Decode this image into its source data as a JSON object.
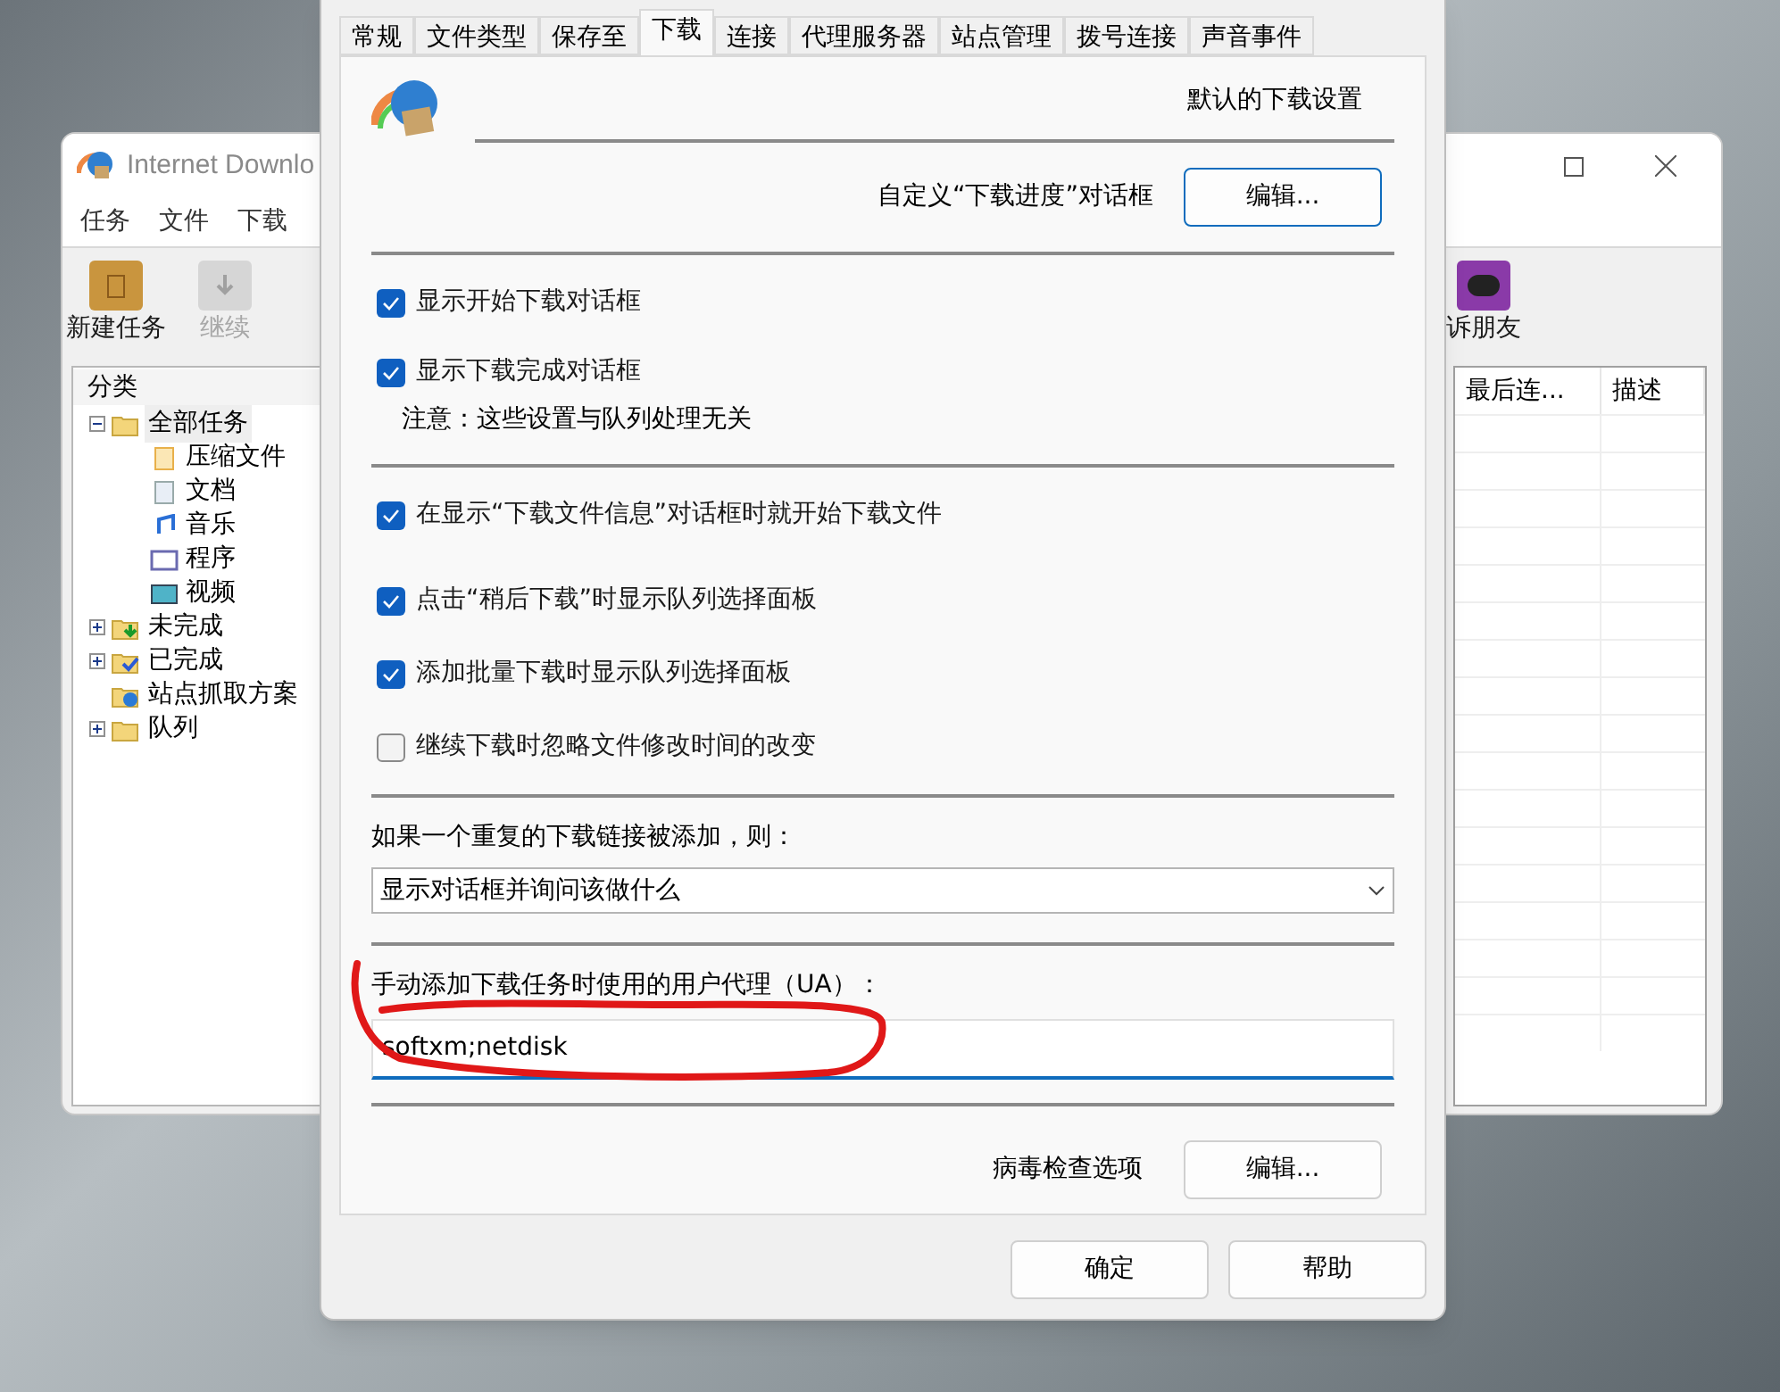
{
  "background_window": {
    "title": "Internet Downlo",
    "menu": [
      "任务",
      "文件",
      "下载"
    ],
    "toolbar": [
      {
        "label": "新建任务",
        "disabled": false,
        "kind": "new"
      },
      {
        "label": "继续",
        "disabled": true,
        "kind": "resume"
      }
    ],
    "toolbar_right": {
      "label": "诉朋友",
      "kind": "tell"
    },
    "tree": {
      "header": "分类",
      "items": [
        {
          "label": "全部任务",
          "kind": "folder-open",
          "expanded": true,
          "has_children": true,
          "selected": true,
          "children": [
            {
              "label": "压缩文件",
              "kind": "archive"
            },
            {
              "label": "文档",
              "kind": "document"
            },
            {
              "label": "音乐",
              "kind": "music"
            },
            {
              "label": "程序",
              "kind": "program"
            },
            {
              "label": "视频",
              "kind": "video"
            }
          ]
        },
        {
          "label": "未完成",
          "kind": "folder-down",
          "expanded": false,
          "has_children": true,
          "selected": false
        },
        {
          "label": "已完成",
          "kind": "folder-check",
          "expanded": false,
          "has_children": true,
          "selected": false
        },
        {
          "label": "站点抓取方案",
          "kind": "folder-web",
          "has_children": false,
          "selected": false
        },
        {
          "label": "队列",
          "kind": "folders",
          "expanded": false,
          "has_children": true,
          "selected": false
        }
      ]
    },
    "columns": [
      "最后连...",
      "描述"
    ]
  },
  "dialog": {
    "tabs": [
      {
        "label": "常规",
        "selected": false
      },
      {
        "label": "文件类型",
        "selected": false
      },
      {
        "label": "保存至",
        "selected": false
      },
      {
        "label": "下载",
        "selected": true
      },
      {
        "label": "连接",
        "selected": false
      },
      {
        "label": "代理服务器",
        "selected": false
      },
      {
        "label": "站点管理",
        "selected": false
      },
      {
        "label": "拨号连接",
        "selected": false
      },
      {
        "label": "声音事件",
        "selected": false
      }
    ],
    "header": "默认的下载设置",
    "progress_row": {
      "label": "自定义“下载进度”对话框",
      "button": "编辑..."
    },
    "group1": [
      {
        "label": "显示开始下载对话框",
        "checked": true
      },
      {
        "label": "显示下载完成对话框",
        "checked": true
      }
    ],
    "note": "注意：这些设置与队列处理无关",
    "group2": [
      {
        "label": "在显示“下载文件信息”对话框时就开始下载文件",
        "checked": true
      },
      {
        "label": "点击“稍后下载”时显示队列选择面板",
        "checked": true
      },
      {
        "label": "添加批量下载时显示队列选择面板",
        "checked": true
      },
      {
        "label": "继续下载时忽略文件修改时间的改变",
        "checked": false
      }
    ],
    "duplicate": {
      "label": "如果一个重复的下载链接被添加，则：",
      "value": "显示对话框并询问该做什么"
    },
    "user_agent": {
      "label": "手动添加下载任务时使用的用户代理（UA）：",
      "value": "softxm;netdisk"
    },
    "virus_row": {
      "label": "病毒检查选项",
      "button": "编辑..."
    },
    "buttons": [
      "确定",
      "帮助"
    ]
  }
}
